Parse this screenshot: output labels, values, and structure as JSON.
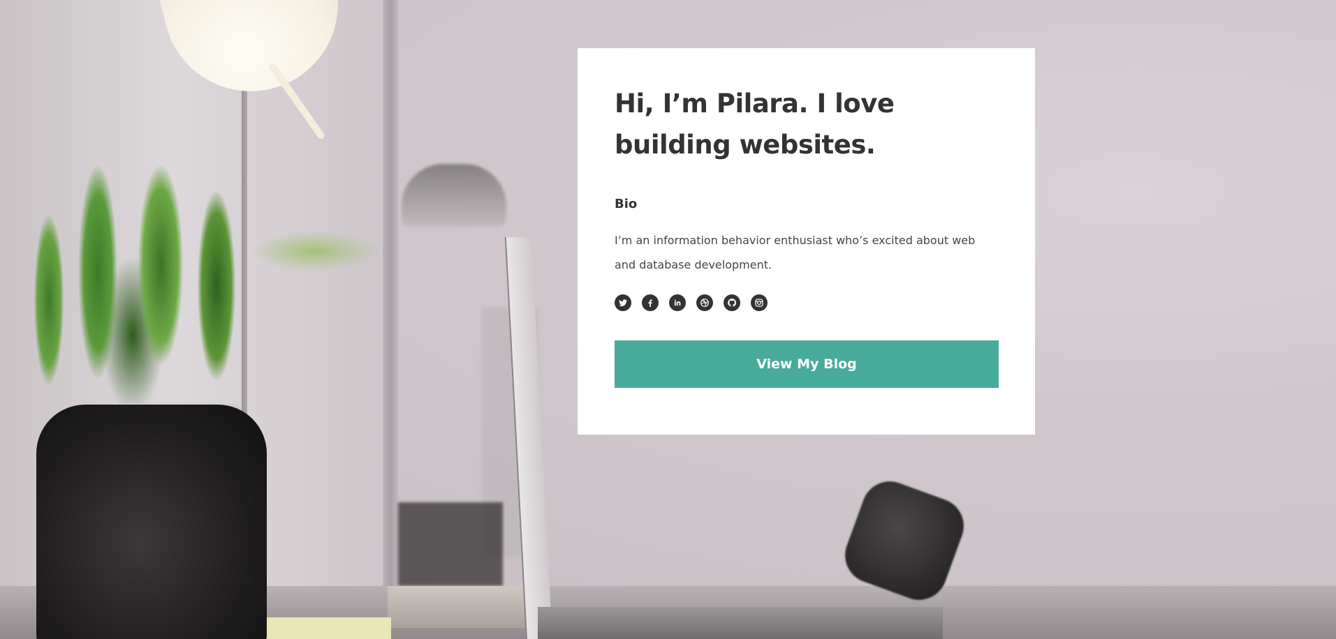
{
  "hero": {
    "title": "Hi, I’m Pilara. I love building websites.",
    "bio_heading": "Bio",
    "bio_text": "I’m an information behavior enthusiast who’s excited about web and database development.",
    "socials": [
      {
        "icon": "twitter-icon"
      },
      {
        "icon": "facebook-icon"
      },
      {
        "icon": "linkedin-icon"
      },
      {
        "icon": "dribbble-icon"
      },
      {
        "icon": "github-icon"
      },
      {
        "icon": "instagram-icon"
      }
    ],
    "button_label": "View My Blog"
  },
  "colors": {
    "accent": "#47ab9b",
    "text": "#333333",
    "card": "#ffffff"
  }
}
